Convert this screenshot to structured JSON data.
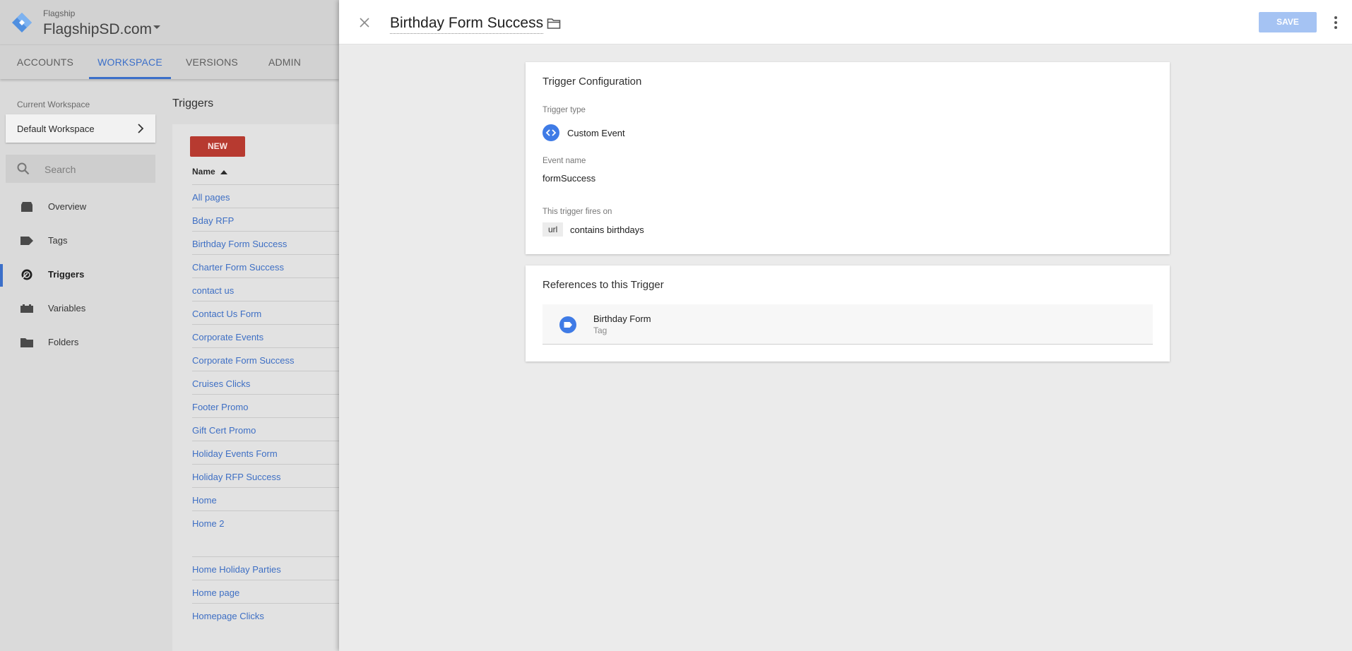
{
  "header": {
    "account_parent": "Flagship",
    "account_name": "FlagshipSD.com"
  },
  "nav": {
    "tabs": [
      {
        "label": "ACCOUNTS",
        "active": false
      },
      {
        "label": "WORKSPACE",
        "active": true
      },
      {
        "label": "VERSIONS",
        "active": false
      },
      {
        "label": "ADMIN",
        "active": false
      }
    ]
  },
  "workspace": {
    "label": "Current Workspace",
    "name": "Default Workspace"
  },
  "search": {
    "placeholder": "Search"
  },
  "sidebar": {
    "items": [
      {
        "label": "Overview",
        "icon": "overview-icon",
        "active": false
      },
      {
        "label": "Tags",
        "icon": "tag-icon",
        "active": false
      },
      {
        "label": "Triggers",
        "icon": "trigger-icon",
        "active": true
      },
      {
        "label": "Variables",
        "icon": "variables-icon",
        "active": false
      },
      {
        "label": "Folders",
        "icon": "folder-icon",
        "active": false
      }
    ]
  },
  "triggers_list": {
    "heading": "Triggers",
    "new_label": "NEW",
    "column_name": "Name",
    "rows": [
      "All pages",
      "Bday RFP",
      "Birthday Form Success",
      "Charter Form Success",
      "contact us",
      "Contact Us Form",
      "Corporate Events",
      "Corporate Form Success",
      "Cruises Clicks",
      "Footer Promo",
      "Gift Cert Promo",
      "Holiday Events Form",
      "Holiday RFP Success",
      "Home",
      "Home 2",
      "Home Holiday Parties",
      "Home page",
      "Homepage Clicks"
    ]
  },
  "panel": {
    "title": "Birthday Form Success",
    "save_label": "SAVE",
    "config": {
      "title": "Trigger Configuration",
      "type_label": "Trigger type",
      "type_value": "Custom Event",
      "event_label": "Event name",
      "event_value": "formSuccess",
      "fires_label": "This trigger fires on",
      "condition_variable": "url",
      "condition_text": "contains birthdays"
    },
    "references": {
      "title": "References to this Trigger",
      "item_name": "Birthday Form",
      "item_type": "Tag"
    }
  },
  "colors": {
    "accent": "#3b6fc9",
    "new_button": "#b73a30",
    "save_button_disabled": "#a5c3f3",
    "link": "#3e6fc4"
  }
}
